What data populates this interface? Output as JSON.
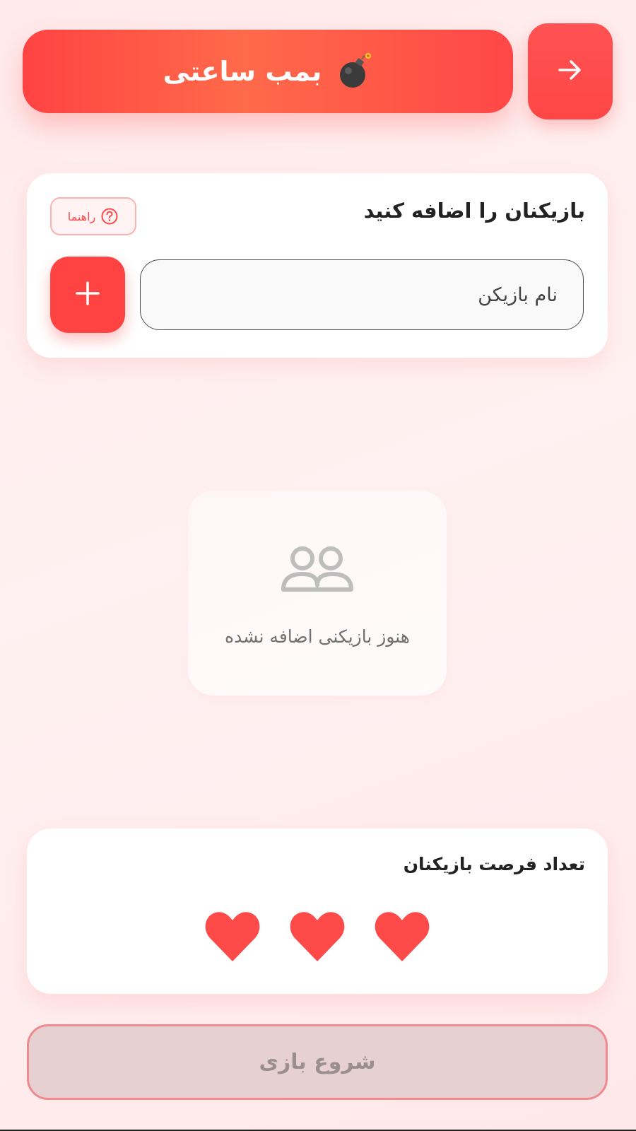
{
  "header": {
    "title": "بمب ساعتی",
    "title_icon": "bomb-icon",
    "back_icon": "arrow-right-icon"
  },
  "add_players": {
    "title": "بازیکنان را اضافه کنید",
    "help_label": "راهنما",
    "help_icon": "question-circle-icon",
    "input_placeholder": "نام بازیکن",
    "input_value": "",
    "add_icon": "plus-icon"
  },
  "players": {
    "items": [],
    "empty_icon": "users-icon",
    "empty_text": "هنوز بازیکنی اضافه نشده"
  },
  "lives": {
    "title": "تعداد فرصت بازیکنان",
    "count": 3,
    "max": 3,
    "heart_color": "#ff4a4a"
  },
  "start": {
    "label": "شروع بازی",
    "disabled": true
  },
  "colors": {
    "accent": "#ff4343",
    "accent_light": "#ff6a4a",
    "background": "#ffeeee"
  }
}
